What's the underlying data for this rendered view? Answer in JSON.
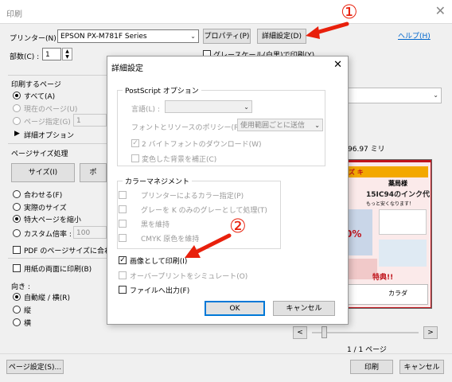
{
  "window": {
    "title": "印刷",
    "close_glyph": "✕"
  },
  "printer": {
    "label": "プリンター(N) :",
    "value": "EPSON PX-M781F Series",
    "properties_label": "プロパティ(P)",
    "advanced_label": "詳細設定(D)",
    "help_label": "ヘルプ(H)"
  },
  "copies": {
    "label": "部数(C) :",
    "value": "1",
    "grayscale_label": "グレースケール(白黒)で印刷(Y)"
  },
  "pages": {
    "heading": "印刷するページ",
    "all_label": "すべて(A)",
    "current_label": "現在のページ(U)",
    "range_label": "ページ指定(G)",
    "range_value": "1",
    "more_options_label": "詳細オプション"
  },
  "sizing": {
    "heading": "ページサイズ処理",
    "size_label": "サイズ(I)",
    "poster_label": "ポ",
    "fit_label": "合わせる(F)",
    "actual_label": "実際のサイズ",
    "shrink_label": "特大ページを縮小",
    "custom_label": "カスタム倍率 :",
    "custom_value": "100",
    "pdf_size_label": "PDF のページサイズに合わ"
  },
  "paper_print": {
    "label": "用紙の両面に印刷(B)"
  },
  "orientation": {
    "heading": "向き :",
    "auto_label": "自動縦 / 横(R)",
    "portrait_label": "縦",
    "landscape_label": "横"
  },
  "preview": {
    "size_text": "96.97 ミリ",
    "page_counter": "1 / 1 ページ",
    "prev_label": "<",
    "next_label": ">",
    "flyer": {
      "banner": "ズ キ",
      "shop": "薬局様",
      "model": "15IC94のインク代",
      "catch": "もっと安くなります！",
      "price": "0%",
      "campaign": "特典!!",
      "store": "カラダ"
    }
  },
  "footer": {
    "page_setup_label": "ページ設定(S)...",
    "print_label": "印刷",
    "cancel_label": "キャンセル"
  },
  "dialog": {
    "title": "詳細設定",
    "close_glyph": "✕",
    "postscript": {
      "heading": "PostScript オプション",
      "language_label": "言語(L) :",
      "font_policy_label": "フォントとリソースのポリシー(R) :",
      "font_policy_value": "使用範囲ごとに送信",
      "download_2byte_label": "2 バイトフォントのダウンロード(W)",
      "correct_color_label": "変色した背景を補正(C)"
    },
    "color": {
      "heading": "カラーマネジメント",
      "printer_color_label": "プリンターによるカラー指定(P)",
      "gray_k_label": "グレーを K のみのグレーとして処理(T)",
      "keep_black_label": "黒を維持",
      "cmyk_label": "CMYK 原色を維持"
    },
    "print_as_image_label": "画像として印刷(I)",
    "overprint_label": "オーバープリントをシミュレート(O)",
    "print_to_file_label": "ファイルへ出力(F)",
    "ok_label": "OK",
    "cancel_label": "キャンセル"
  },
  "annotations": {
    "step1": "①",
    "step2": "②",
    "color": "#e8200c"
  }
}
